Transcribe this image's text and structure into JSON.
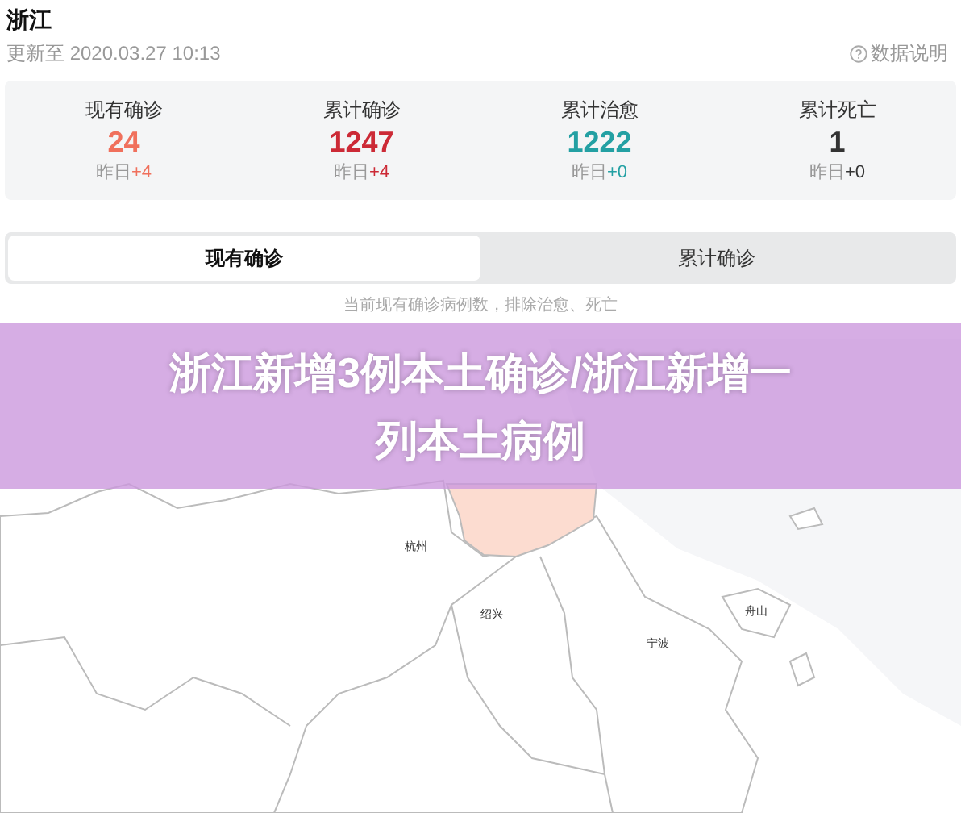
{
  "header": {
    "title": "浙江",
    "updated": "更新至 2020.03.27 10:13",
    "help_link": "数据说明"
  },
  "stats": [
    {
      "label": "现有确诊",
      "value": "24",
      "delta_label": "昨日",
      "delta": "+4",
      "color": "#f0705c"
    },
    {
      "label": "累计确诊",
      "value": "1247",
      "delta_label": "昨日",
      "delta": "+4",
      "color": "#cc2a36"
    },
    {
      "label": "累计治愈",
      "value": "1222",
      "delta_label": "昨日",
      "delta": "+0",
      "color": "#23a0a3"
    },
    {
      "label": "累计死亡",
      "value": "1",
      "delta_label": "昨日",
      "delta": "+0",
      "color": "#333333"
    }
  ],
  "tabs": [
    {
      "label": "现有确诊",
      "selected": true
    },
    {
      "label": "累计确诊",
      "selected": false
    }
  ],
  "map": {
    "caption": "当前现有确诊病例数，排除治愈、死亡",
    "cities": [
      {
        "name": "杭州"
      },
      {
        "name": "绍兴"
      },
      {
        "name": "宁波"
      },
      {
        "name": "舟山"
      }
    ]
  },
  "banner": {
    "title": "浙江新增3例本土确诊/浙江新增一列本土病例"
  }
}
